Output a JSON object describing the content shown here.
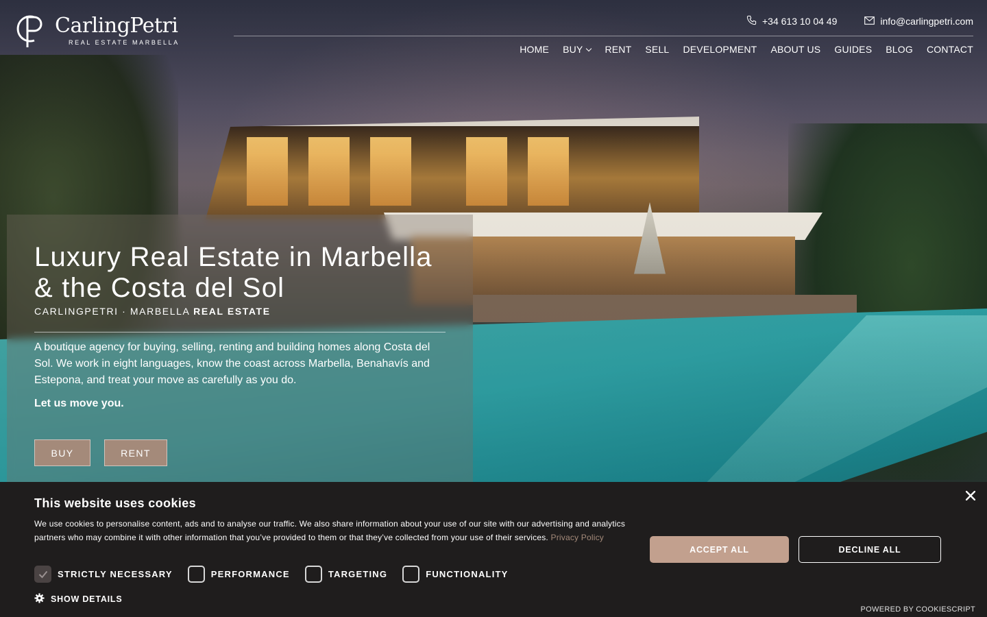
{
  "header": {
    "logo_name": "CarlingPetri",
    "logo_subtitle": "REAL ESTATE MARBELLA",
    "phone": "+34 613 10 04 49",
    "email": "info@carlingpetri.com",
    "nav": [
      "HOME",
      "BUY",
      "RENT",
      "SELL",
      "DEVELOPMENT",
      "ABOUT US",
      "GUIDES",
      "BLOG",
      "CONTACT"
    ]
  },
  "hero": {
    "title": "Luxury Real Estate in Marbella & the Costa del Sol",
    "subtitle_light": "CARLINGPETRI · MARBELLA",
    "subtitle_bold": "REAL ESTATE",
    "description": "A boutique agency for buying, selling, renting and building homes along Costa del Sol. We work in eight languages, know the coast across Marbella, Benahavís and Estepona, and treat your move as carefully as you do.",
    "tagline": "Let us move you.",
    "buy_label": "BUY",
    "rent_label": "RENT",
    "accent_color": "#a48a7a"
  },
  "cookie": {
    "title": "This website uses cookies",
    "text": "We use cookies to personalise content, ads and to analyse our traffic. We also share information about your use of our site with our advertising and analytics partners who may combine it with other information that you’ve provided to them or that they’ve collected from your use of their services.",
    "privacy_link": "Privacy Policy",
    "toggles": [
      {
        "label": "STRICTLY NECESSARY",
        "checked": true
      },
      {
        "label": "PERFORMANCE",
        "checked": false
      },
      {
        "label": "TARGETING",
        "checked": false
      },
      {
        "label": "FUNCTIONALITY",
        "checked": false
      }
    ],
    "show_details": "SHOW DETAILS",
    "accept_label": "ACCEPT ALL",
    "decline_label": "DECLINE ALL",
    "powered_by": "POWERED BY COOKIESCRIPT",
    "accept_color": "#c2a08e",
    "background_color": "#1f1d1d"
  },
  "icons": [
    "logo-mark-icon",
    "phone-icon",
    "mail-icon",
    "chevron-down-icon",
    "close-icon",
    "check-icon",
    "gear-icon"
  ]
}
